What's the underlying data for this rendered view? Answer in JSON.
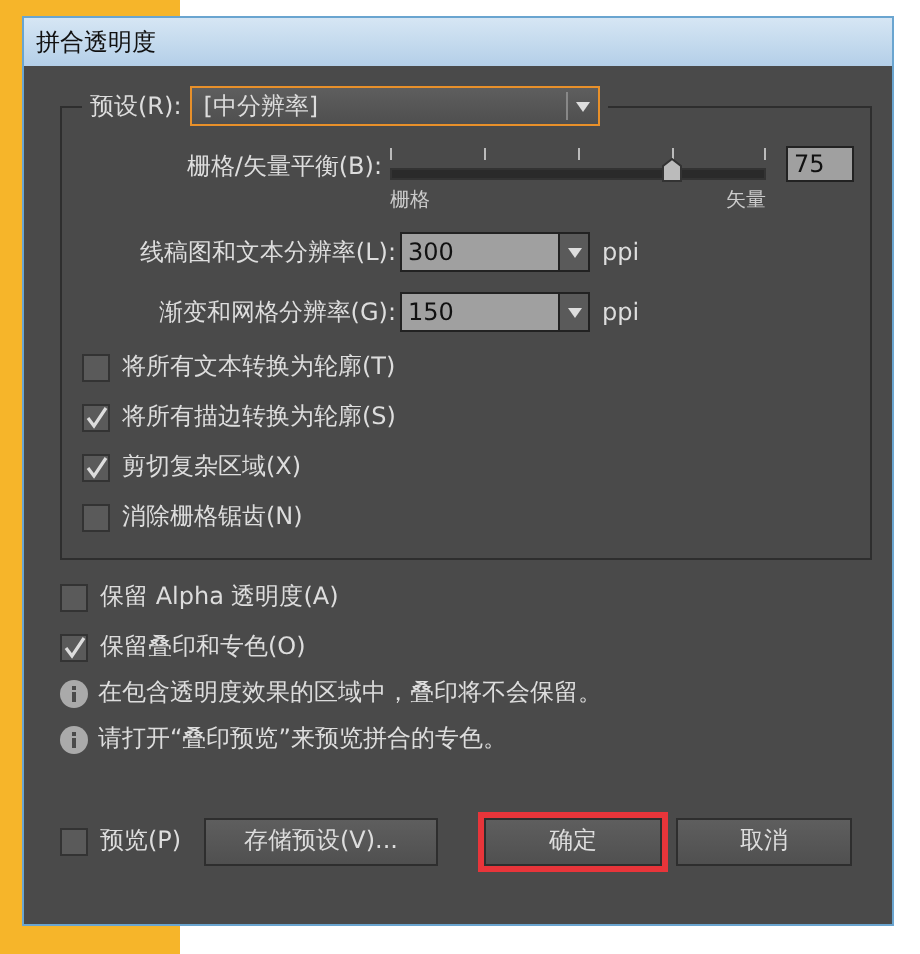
{
  "window": {
    "title": "拼合透明度"
  },
  "preset": {
    "label": "预设(R):",
    "value": "[中分辨率]"
  },
  "balance": {
    "label": "栅格/矢量平衡(B):",
    "level": 0.75,
    "value": "75",
    "min_label": "栅格",
    "max_label": "矢量"
  },
  "resolutions": [
    {
      "label": "线稿图和文本分辨率(L):",
      "value": "300",
      "unit": "ppi"
    },
    {
      "label": "渐变和网格分辨率(G):",
      "value": "150",
      "unit": "ppi"
    }
  ],
  "options": [
    {
      "label": "将所有文本转换为轮廓(T)",
      "checked": false
    },
    {
      "label": "将所有描边转换为轮廓(S)",
      "checked": true
    },
    {
      "label": "剪切复杂区域(X)",
      "checked": true
    },
    {
      "label": "消除栅格锯齿(N)",
      "checked": false
    }
  ],
  "extra_options": [
    {
      "label": "保留 Alpha 透明度(A)",
      "checked": false
    },
    {
      "label": "保留叠印和专色(O)",
      "checked": true
    }
  ],
  "notes": [
    "在包含透明度效果的区域中，叠印将不会保留。",
    "请打开“叠印预览”来预览拼合的专色。"
  ],
  "preview": {
    "label": "预览(P)",
    "checked": false
  },
  "buttons": [
    {
      "label": "存储预设(V)...",
      "highlighted": false
    },
    {
      "label": "确定",
      "highlighted": true
    },
    {
      "label": "取消",
      "highlighted": false
    }
  ]
}
